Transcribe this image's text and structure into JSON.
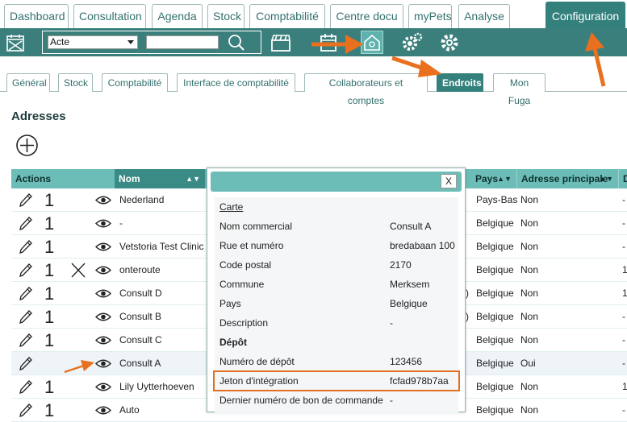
{
  "top_tabs": [
    "Dashboard",
    "Consultation",
    "Agenda",
    "Stock",
    "Comptabilité",
    "Centre docu",
    "myPets",
    "Analyse",
    "Configuration"
  ],
  "toolbar": {
    "select_value": "Acte",
    "search_value": ""
  },
  "sub_tabs": [
    "Général",
    "Stock",
    "Comptabilité",
    "Interface de comptabilité",
    "Collaborateurs et comptes",
    "Endroits",
    "Mon Fuga"
  ],
  "section_title": "Adresses",
  "table": {
    "headers": {
      "actions": "Actions",
      "nom": "Nom",
      "pays": "Pays",
      "principale": "Adresse principale",
      "d": "D"
    },
    "rows": [
      {
        "count": "1",
        "nom": "Nederland",
        "mid": "",
        "pays": "Pays-Bas",
        "principale": "Non",
        "d": "-",
        "x_icon": false
      },
      {
        "count": "1",
        "nom": "-",
        "mid": "",
        "pays": "Belgique",
        "principale": "Non",
        "d": "-",
        "x_icon": false
      },
      {
        "count": "1",
        "nom": "Vetstoria Test Clinic",
        "mid": "",
        "pays": "Belgique",
        "principale": "Non",
        "d": "-",
        "x_icon": false
      },
      {
        "count": "1",
        "nom": "onteroute",
        "mid": "",
        "pays": "Belgique",
        "principale": "Non",
        "d": "1",
        "x_icon": true
      },
      {
        "count": "1",
        "nom": "Consult D",
        "mid": ")",
        "pays": "Belgique",
        "principale": "Non",
        "d": "1",
        "x_icon": false
      },
      {
        "count": "1",
        "nom": "Consult B",
        "mid": ")",
        "pays": "Belgique",
        "principale": "Non",
        "d": "-",
        "x_icon": false
      },
      {
        "count": "1",
        "nom": "Consult C",
        "mid": "",
        "pays": "Belgique",
        "principale": "Non",
        "d": "-",
        "x_icon": false
      },
      {
        "count": "",
        "nom": "Consult A",
        "mid": "",
        "pays": "Belgique",
        "principale": "Oui",
        "d": "-",
        "x_icon": false
      },
      {
        "count": "1",
        "nom": "Lily Uytterhoeven",
        "mid": "",
        "pays": "Belgique",
        "principale": "Non",
        "d": "1",
        "x_icon": false
      },
      {
        "count": "1",
        "nom": "Auto",
        "mid": "",
        "pays": "Belgique",
        "principale": "Non",
        "d": "-",
        "x_icon": false
      }
    ]
  },
  "popup": {
    "close_label": "X",
    "carte_label": "Carte",
    "fields": [
      {
        "label": "Nom commercial",
        "value": "Consult A"
      },
      {
        "label": "Rue et numéro",
        "value": "bredabaan 100"
      },
      {
        "label": "Code postal",
        "value": "2170"
      },
      {
        "label": "Commune",
        "value": "Merksem"
      },
      {
        "label": "Pays",
        "value": "Belgique"
      },
      {
        "label": "Description",
        "value": "-"
      }
    ],
    "depot_title": "Dépôt",
    "depot_fields": [
      {
        "label": "Numéro de dépôt",
        "value": "123456"
      },
      {
        "label": "Jeton d'intégration",
        "value": "fcfad978b7aa"
      },
      {
        "label": "Dernier numéro de bon de commande",
        "value": "-"
      }
    ]
  },
  "colors": {
    "teal_dark": "#34807d",
    "teal_light": "#6cbdb8",
    "arrow": "#e8701e",
    "highlight_border": "#e07020"
  }
}
